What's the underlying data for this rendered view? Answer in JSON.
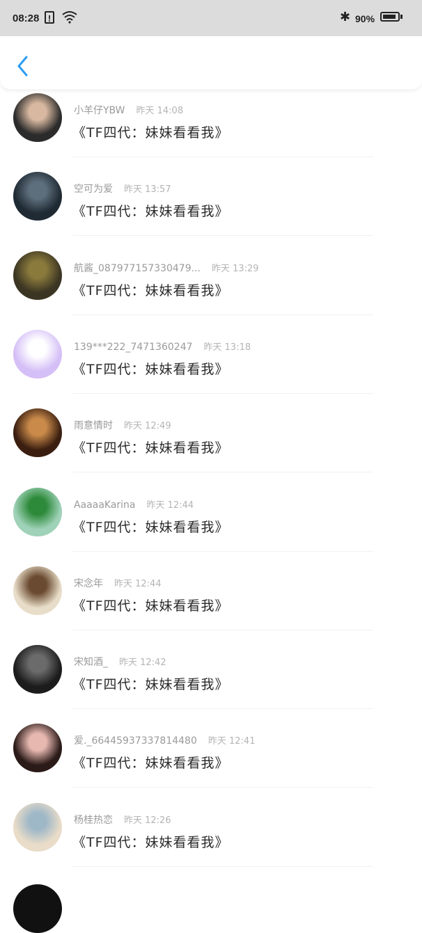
{
  "status_bar": {
    "time": "08:28",
    "alert_glyph": "!",
    "bluetooth_glyph": "✱",
    "battery_text": "90%",
    "battery_level": 0.9
  },
  "header": {
    "back_icon": "chevron-left-icon",
    "accent_color": "#2a9df4"
  },
  "comments": [
    {
      "name": "小羊仔YBW",
      "time": "昨天 14:08",
      "message": "《TF四代：妹妹看看我》",
      "avatar_colors": [
        "#2b2b2b",
        "#d8b8a0"
      ]
    },
    {
      "name": "空可为爱",
      "time": "昨天 13:57",
      "message": "《TF四代：妹妹看看我》",
      "avatar_colors": [
        "#1f2a33",
        "#5d6e7c"
      ]
    },
    {
      "name": "航酱_087977157330479...",
      "time": "昨天 13:29",
      "message": "《TF四代：妹妹看看我》",
      "avatar_colors": [
        "#3b3523",
        "#8a7a3c"
      ]
    },
    {
      "name": "139***222_7471360247",
      "time": "昨天 13:18",
      "message": "《TF四代：妹妹看看我》",
      "avatar_colors": [
        "#d5bff7",
        "#ffffff"
      ]
    },
    {
      "name": "雨意情时",
      "time": "昨天 12:49",
      "message": "《TF四代：妹妹看看我》",
      "avatar_colors": [
        "#3a1e10",
        "#c98a4a"
      ]
    },
    {
      "name": "AaaaaKarina",
      "time": "昨天 12:44",
      "message": "《TF四代：妹妹看看我》",
      "avatar_colors": [
        "#9fd2b8",
        "#2d8a3a"
      ]
    },
    {
      "name": "宋念年",
      "time": "昨天 12:44",
      "message": "《TF四代：妹妹看看我》",
      "avatar_colors": [
        "#e8ddc8",
        "#6a4a30"
      ]
    },
    {
      "name": "宋知酒_",
      "time": "昨天 12:42",
      "message": "《TF四代：妹妹看看我》",
      "avatar_colors": [
        "#1c1c1c",
        "#6b6b6b"
      ]
    },
    {
      "name": "爱._66445937337814480",
      "time": "昨天 12:41",
      "message": "《TF四代：妹妹看看我》",
      "avatar_colors": [
        "#2a1a18",
        "#e7b8b0"
      ]
    },
    {
      "name": "杨桂热恋",
      "time": "昨天 12:26",
      "message": "《TF四代：妹妹看看我》",
      "avatar_colors": [
        "#e9dcc8",
        "#9fb8c8"
      ]
    }
  ]
}
